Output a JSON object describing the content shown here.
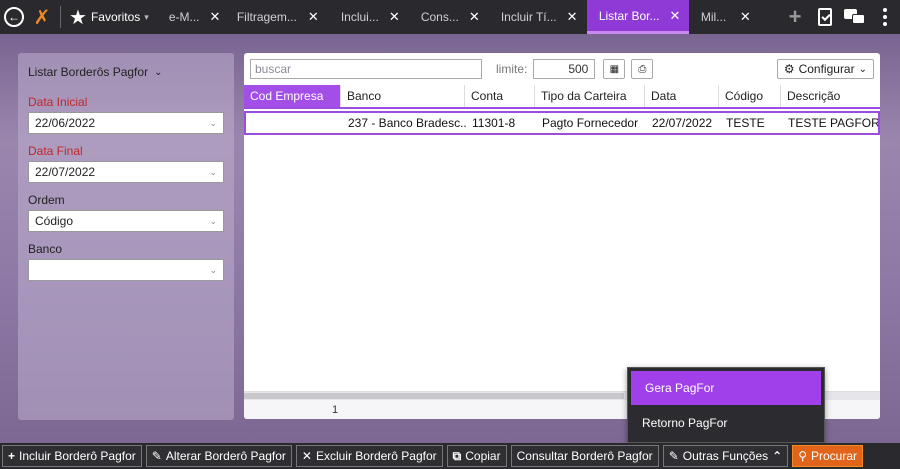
{
  "topbar": {
    "favorites_label": "Favoritos",
    "tabs": [
      {
        "label": "e-M..."
      },
      {
        "label": "Filtragem..."
      },
      {
        "label": "Inclui..."
      },
      {
        "label": "Cons..."
      },
      {
        "label": "Incluir Tí..."
      },
      {
        "label": "Listar Bor...",
        "active": true
      },
      {
        "label": "Mil..."
      }
    ]
  },
  "filter": {
    "title": "Listar Borderôs Pagfor",
    "data_inicial_label": "Data Inicial",
    "data_inicial_value": "22/06/2022",
    "data_final_label": "Data Final",
    "data_final_value": "22/07/2022",
    "ordem_label": "Ordem",
    "ordem_value": "Código",
    "banco_label": "Banco",
    "banco_value": ""
  },
  "grid": {
    "search_placeholder": "buscar",
    "limit_label": "limite:",
    "limit_value": "500",
    "config_label": "Configurar",
    "columns": [
      "Cod Empresa",
      "Banco",
      "Conta",
      "Tipo da Carteira",
      "Data",
      "Código",
      "Descrição"
    ],
    "rows": [
      [
        "",
        "237 - Banco Bradesc...",
        "11301-8",
        "Pagto Fornecedor",
        "22/07/2022",
        "TESTE",
        "TESTE PAGFOR"
      ]
    ],
    "page": "1"
  },
  "popup": {
    "items": [
      "Gera PagFor",
      "Retorno PagFor"
    ]
  },
  "bottombar": {
    "incluir": "Incluir Borderô Pagfor",
    "alterar": "Alterar Borderô Pagfor",
    "excluir": "Excluir Borderô Pagfor",
    "copiar": "Copiar",
    "consultar": "Consultar Borderô Pagfor",
    "outras": "Outras Funções",
    "procurar": "Procurar"
  },
  "colors": {
    "accent": "#a34ee6",
    "required": "#c0282b",
    "orange": "#e0641a"
  }
}
